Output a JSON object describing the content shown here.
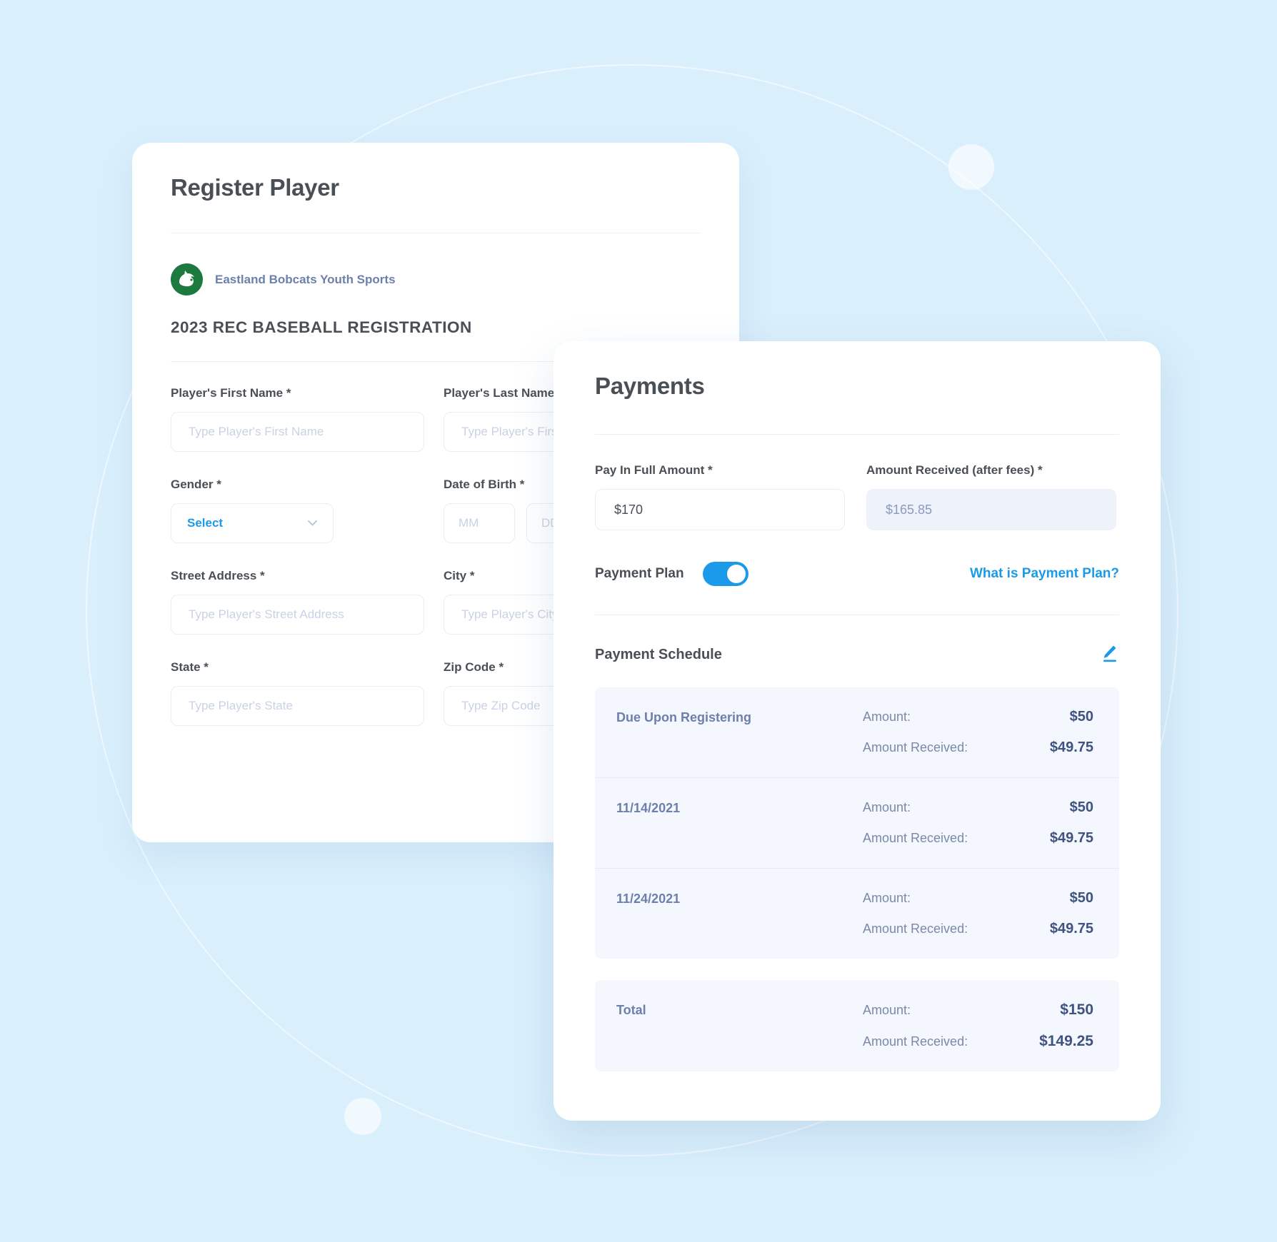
{
  "background": {
    "color": "#d9effc",
    "accent": "#1a9ae8"
  },
  "register_card": {
    "title": "Register Player",
    "org": {
      "logo_icon": "bobcat-logo-icon",
      "name": "Eastland Bobcats Youth Sports",
      "logo_color": "#1c7a3e"
    },
    "form_heading": "2023 REC BASEBALL REGISTRATION",
    "fields": {
      "first_name": {
        "label": "Player's First Name *",
        "placeholder": "Type Player's First Name",
        "value": ""
      },
      "last_name": {
        "label": "Player's Last Name *",
        "placeholder": "Type Player's First Name",
        "value": ""
      },
      "gender": {
        "label": "Gender *",
        "selected": "Select"
      },
      "dob": {
        "label": "Date of Birth *",
        "month_placeholder": "MM",
        "day_placeholder": "DD"
      },
      "street_address": {
        "label": "Street Address *",
        "placeholder": "Type Player's Street Address",
        "value": ""
      },
      "city": {
        "label": "City *",
        "placeholder": "Type Player's City",
        "value": ""
      },
      "state": {
        "label": "State *",
        "placeholder": "Type Player's State",
        "value": ""
      },
      "zip": {
        "label": "Zip Code *",
        "placeholder": "Type Zip Code",
        "value": ""
      }
    }
  },
  "payments_card": {
    "title": "Payments",
    "pay_in_full": {
      "label": "Pay In Full Amount *",
      "value": "$170"
    },
    "amount_received": {
      "label": "Amount Received (after fees) *",
      "value": "$165.85"
    },
    "payment_plan": {
      "label": "Payment Plan",
      "enabled": true,
      "help_link": "What is Payment Plan?"
    },
    "schedule": {
      "title": "Payment Schedule",
      "edit_icon": "pencil-icon",
      "amount_label": "Amount:",
      "amount_received_label": "Amount Received:",
      "rows": [
        {
          "name": "Due Upon Registering",
          "amount": "$50",
          "amount_received": "$49.75"
        },
        {
          "name": "11/14/2021",
          "amount": "$50",
          "amount_received": "$49.75"
        },
        {
          "name": "11/24/2021",
          "amount": "$50",
          "amount_received": "$49.75"
        }
      ],
      "total": {
        "name": "Total",
        "amount": "$150",
        "amount_received": "$149.25"
      }
    }
  }
}
